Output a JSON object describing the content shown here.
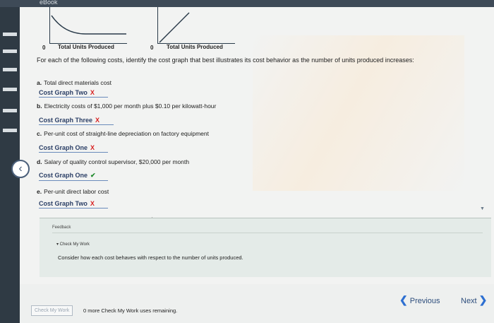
{
  "header": {
    "brand": "eBook"
  },
  "graphs": {
    "left": {
      "zero": "0",
      "xlabel": "Total Units Produced"
    },
    "right": {
      "zero": "0",
      "xlabel": "Total Units Produced"
    }
  },
  "question": "For each of the following costs, identify the cost graph that best illustrates its cost behavior as the number of units produced increases:",
  "items": [
    {
      "bullet": "a.",
      "text": "Total direct materials cost",
      "answer": "Cost Graph Two",
      "mark": "X",
      "status": "incorrect"
    },
    {
      "bullet": "b.",
      "text": "Electricity costs of $1,000 per month plus $0.10 per kilowatt-hour",
      "answer": "Cost Graph Three",
      "mark": "X",
      "status": "incorrect"
    },
    {
      "bullet": "c.",
      "text": "Per-unit cost of straight-line depreciation on factory equipment",
      "answer": "Cost Graph One",
      "mark": "X",
      "status": "incorrect"
    },
    {
      "bullet": "d.",
      "text": "Salary of quality control supervisor, $20,000 per month",
      "answer": "Cost Graph One",
      "mark": "✔",
      "status": "correct"
    },
    {
      "bullet": "e.",
      "text": "Per-unit direct labor cost",
      "answer": "Cost Graph Two",
      "mark": "X",
      "status": "incorrect"
    }
  ],
  "feedback": {
    "title": "Feedback",
    "link": "▾ Check My Work",
    "text": "Consider how each cost behaves with respect to the number of units produced."
  },
  "footer": {
    "check_button": "Check My Work",
    "uses_remaining": "0 more Check My Work uses remaining.",
    "previous": "Previous",
    "next": "Next"
  },
  "colors": {
    "incorrect": "#d82020",
    "correct": "#1f8a2c",
    "link": "#2d6fd1"
  }
}
